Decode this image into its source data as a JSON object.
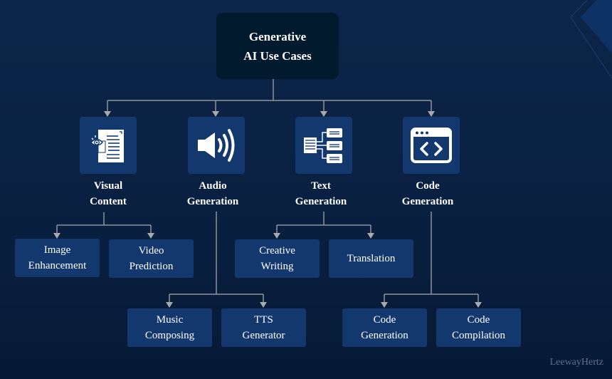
{
  "root": {
    "line1": "Generative",
    "line2": "AI Use Cases"
  },
  "categories": [
    {
      "icon": "document-eye-icon",
      "line1": "Visual",
      "line2": "Content",
      "children": [
        {
          "line1": "Image",
          "line2": "Enhancement"
        },
        {
          "line1": "Video",
          "line2": "Prediction"
        }
      ]
    },
    {
      "icon": "speaker-icon",
      "line1": "Audio",
      "line2": "Generation",
      "children": [
        {
          "line1": "Music",
          "line2": "Composing"
        },
        {
          "line1": "TTS",
          "line2": "Generator"
        }
      ]
    },
    {
      "icon": "text-tree-icon",
      "line1": "Text",
      "line2": "Generation",
      "children": [
        {
          "line1": "Creative",
          "line2": "Writing"
        },
        {
          "line1": "Translation",
          "line2": ""
        }
      ]
    },
    {
      "icon": "code-window-icon",
      "line1": "Code",
      "line2": "Generation",
      "children": [
        {
          "line1": "Code",
          "line2": "Generation"
        },
        {
          "line1": "Code",
          "line2": "Compilation"
        }
      ]
    }
  ],
  "brand": "LeewayHertz",
  "colors": {
    "background": "#0a2143",
    "root_box": "#021a2e",
    "node_box": "#12386d",
    "connector": "#9a9fa6",
    "text": "#ffffff"
  }
}
